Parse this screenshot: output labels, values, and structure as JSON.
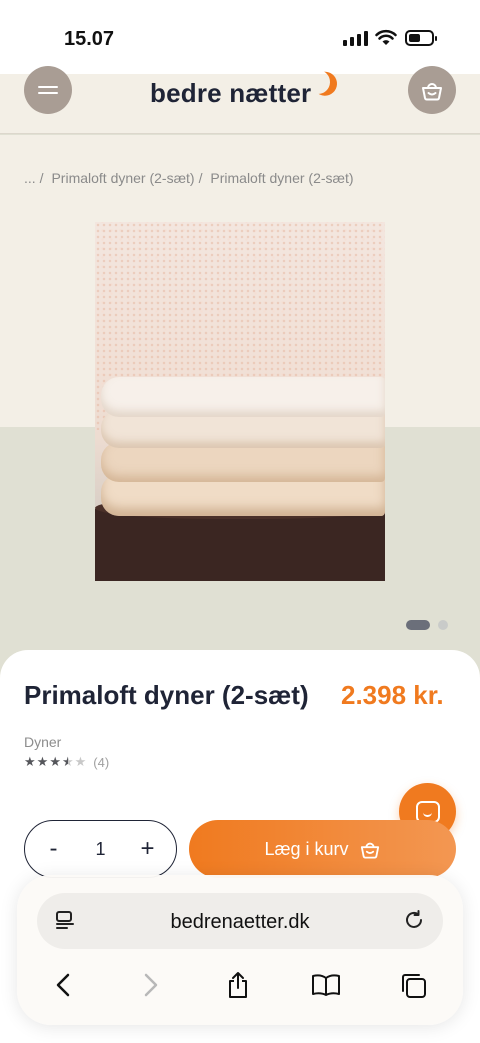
{
  "status_bar": {
    "time": "15.07"
  },
  "header": {
    "logo": "bedre nætter"
  },
  "breadcrumb": [
    "...",
    "Primaloft dyner (2-sæt)",
    "Primaloft dyner (2-sæt)"
  ],
  "product": {
    "title": "Primaloft dyner (2-sæt)",
    "price": "2.398 kr.",
    "category": "Dyner",
    "rating": 3.5,
    "rating_max": 5,
    "review_count": "(4)",
    "quantity": "1",
    "add_to_cart": "Læg i kurv"
  },
  "gallery": {
    "slides": 2,
    "active_slide": 1
  },
  "browser": {
    "url": "bedrenaetter.dk"
  },
  "colors": {
    "accent": "#f07a1f",
    "brand_text": "#1f2436",
    "header_btn": "#a99d94"
  },
  "icons": [
    "menu-icon",
    "basket-icon",
    "chat-icon",
    "page-icon",
    "reload-icon",
    "back-icon",
    "forward-icon",
    "share-icon",
    "bookmarks-icon",
    "tabs-icon"
  ]
}
